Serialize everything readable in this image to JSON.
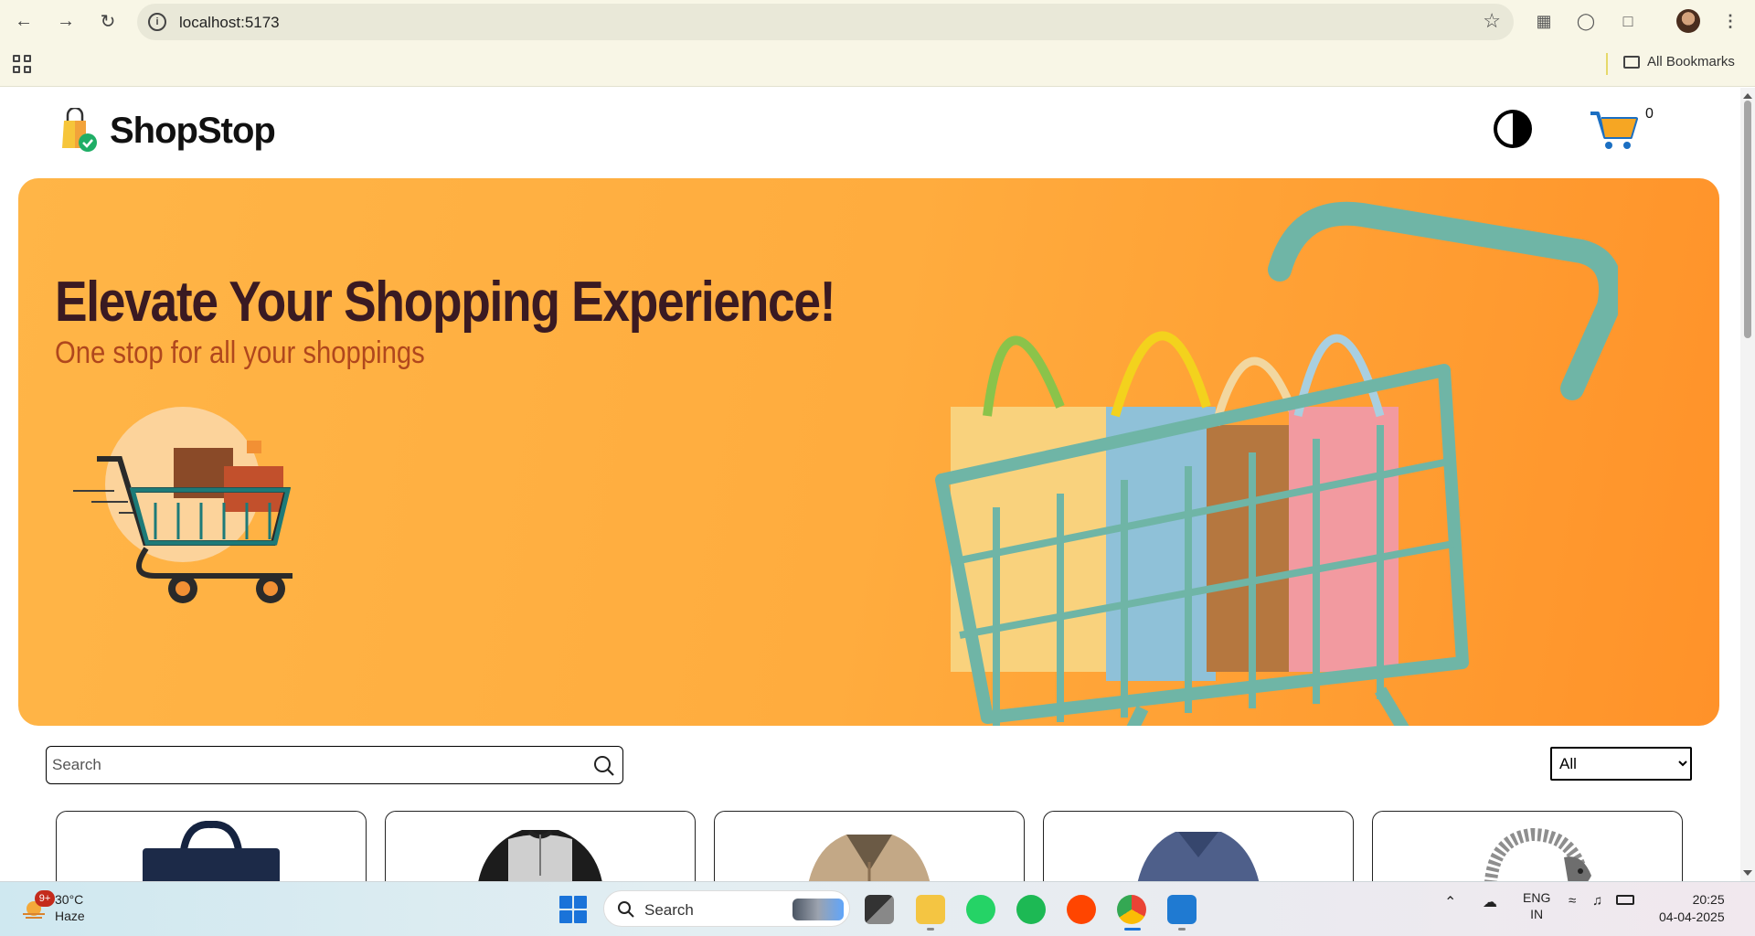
{
  "browser": {
    "url": "localhost:5173",
    "bookmarks_label": "All Bookmarks"
  },
  "header": {
    "brand": "ShopStop",
    "cart_count": "0"
  },
  "hero": {
    "title": "Elevate Your Shopping Experience!",
    "subtitle": "One stop for all your shoppings"
  },
  "filters": {
    "search_placeholder": "Search",
    "category_selected": "All"
  },
  "products": [
    {
      "image": "navy-bag"
    },
    {
      "image": "raglan-tshirt"
    },
    {
      "image": "beige-jacket"
    },
    {
      "image": "blue-vneck-shirt"
    },
    {
      "image": "dragon-bracelet"
    }
  ],
  "taskbar": {
    "weather_temp": "30°C",
    "weather_desc": "Haze",
    "weather_badge": "9+",
    "search_label": "Search",
    "lang_top": "ENG",
    "lang_bottom": "IN",
    "time": "20:25",
    "date": "04-04-2025"
  },
  "colors": {
    "hero_orange": "#ffac3e",
    "hero_title": "#3a1a22",
    "hero_subtitle": "#b0471d",
    "cart_teal": "#6fb5a6"
  }
}
